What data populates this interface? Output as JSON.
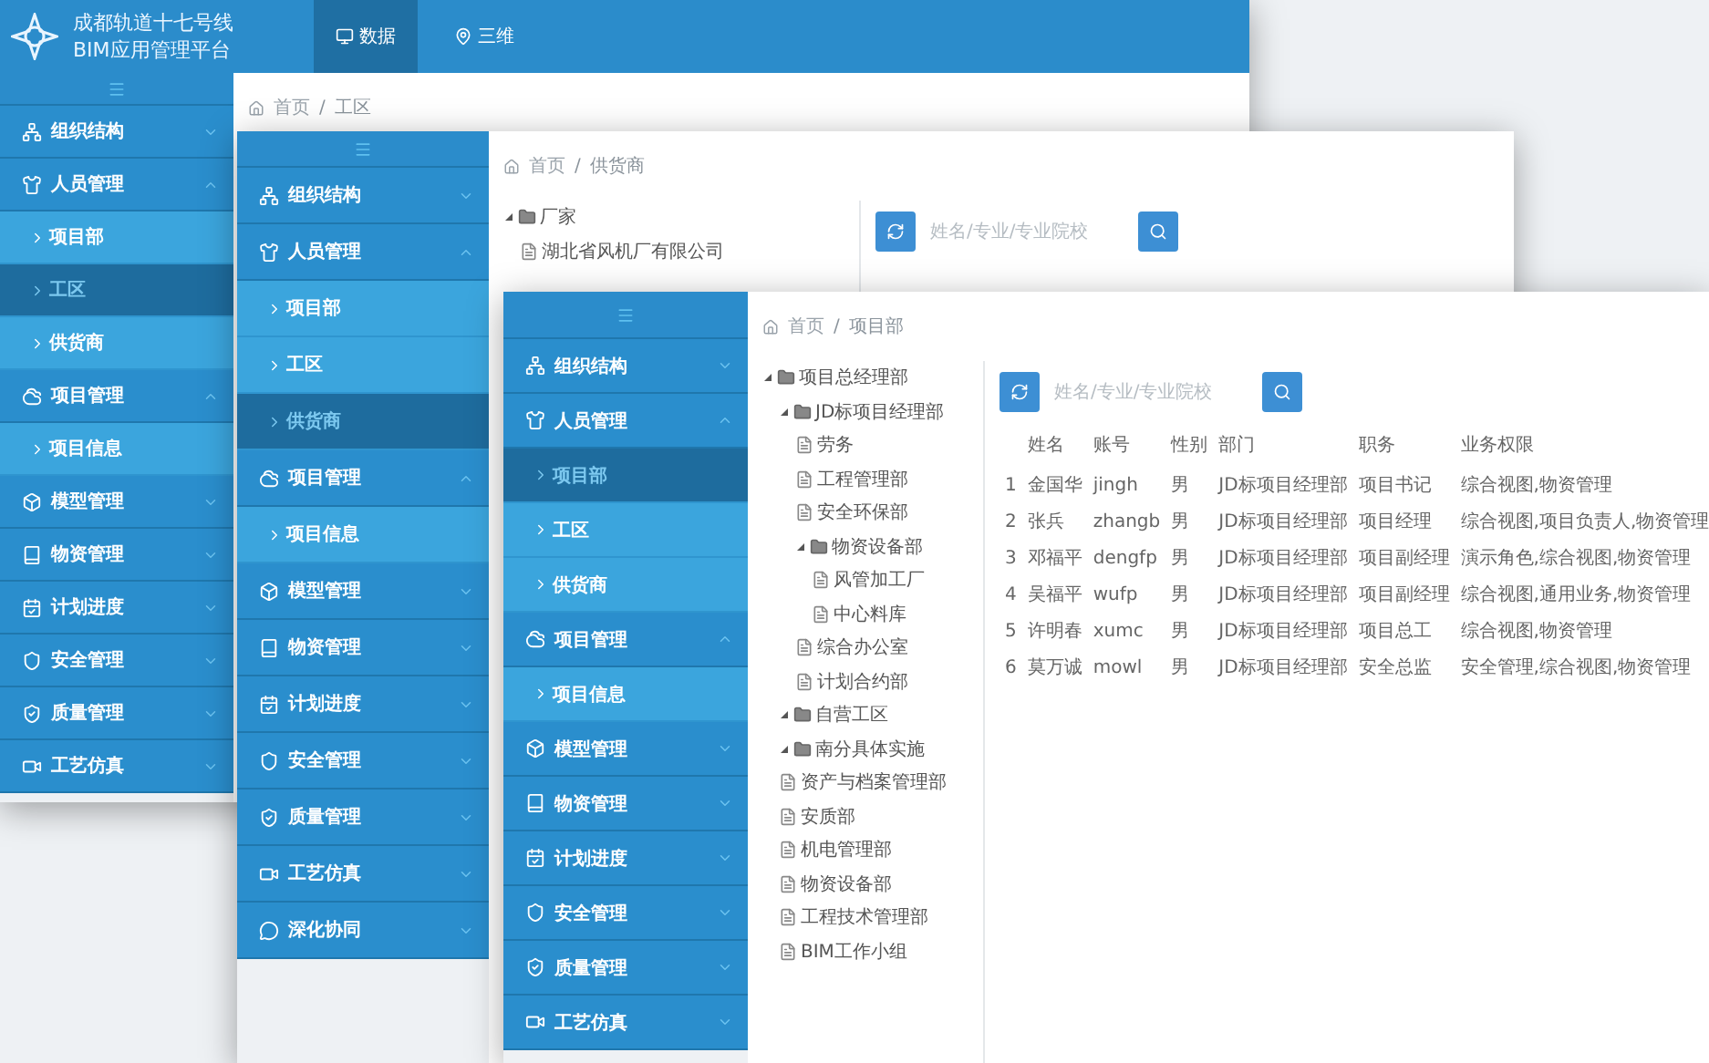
{
  "windows": [
    {
      "header": {
        "title": "成都轨道十七号线",
        "subtitle": "BIM应用管理平台",
        "tabs": [
          {
            "label": "数据",
            "selected": true
          },
          {
            "label": "三维",
            "selected": false
          }
        ]
      },
      "sidebar": {
        "groups": [
          {
            "label": "组织结构",
            "expanded": false
          },
          {
            "label": "人员管理",
            "expanded": true,
            "children": [
              {
                "label": "项目部",
                "selected": false
              },
              {
                "label": "工区",
                "selected": true
              },
              {
                "label": "供货商",
                "selected": false
              }
            ]
          },
          {
            "label": "项目管理",
            "expanded": true,
            "children": [
              {
                "label": "项目信息",
                "selected": false
              }
            ]
          },
          {
            "label": "模型管理",
            "expanded": false
          },
          {
            "label": "物资管理",
            "expanded": false
          },
          {
            "label": "计划进度",
            "expanded": false
          },
          {
            "label": "安全管理",
            "expanded": false
          },
          {
            "label": "质量管理",
            "expanded": false
          },
          {
            "label": "工艺仿真",
            "expanded": false
          }
        ]
      },
      "breadcrumb": {
        "home": "首页",
        "separator": "/",
        "current": "工区"
      }
    },
    {
      "sidebar": {
        "groups": [
          {
            "label": "组织结构",
            "expanded": false
          },
          {
            "label": "人员管理",
            "expanded": true,
            "children": [
              {
                "label": "项目部",
                "selected": false
              },
              {
                "label": "工区",
                "selected": false
              },
              {
                "label": "供货商",
                "selected": true
              }
            ]
          },
          {
            "label": "项目管理",
            "expanded": true,
            "children": [
              {
                "label": "项目信息",
                "selected": false
              }
            ]
          },
          {
            "label": "模型管理",
            "expanded": false
          },
          {
            "label": "物资管理",
            "expanded": false
          },
          {
            "label": "计划进度",
            "expanded": false
          },
          {
            "label": "安全管理",
            "expanded": false
          },
          {
            "label": "质量管理",
            "expanded": false
          },
          {
            "label": "工艺仿真",
            "expanded": false
          },
          {
            "label": "深化协同",
            "expanded": false
          }
        ]
      },
      "breadcrumb": {
        "home": "首页",
        "separator": "/",
        "current": "供货商"
      },
      "tree": [
        {
          "label": "厂家",
          "kind": "folder",
          "expanded": true,
          "children": [
            {
              "label": "湖北省风机厂有限公司",
              "kind": "file"
            }
          ]
        }
      ],
      "search": {
        "placeholder": "姓名/专业/专业院校"
      }
    },
    {
      "sidebar": {
        "groups": [
          {
            "label": "组织结构",
            "expanded": false
          },
          {
            "label": "人员管理",
            "expanded": true,
            "children": [
              {
                "label": "项目部",
                "selected": true
              },
              {
                "label": "工区",
                "selected": false
              },
              {
                "label": "供货商",
                "selected": false
              }
            ]
          },
          {
            "label": "项目管理",
            "expanded": true,
            "children": [
              {
                "label": "项目信息",
                "selected": false
              }
            ]
          },
          {
            "label": "模型管理",
            "expanded": false
          },
          {
            "label": "物资管理",
            "expanded": false
          },
          {
            "label": "计划进度",
            "expanded": false
          },
          {
            "label": "安全管理",
            "expanded": false
          },
          {
            "label": "质量管理",
            "expanded": false
          },
          {
            "label": "工艺仿真",
            "expanded": false
          }
        ]
      },
      "breadcrumb": {
        "home": "首页",
        "separator": "/",
        "current": "项目部"
      },
      "tree": [
        {
          "label": "项目总经理部",
          "kind": "folder",
          "expanded": true,
          "children": [
            {
              "label": "JD标项目经理部",
              "kind": "folder",
              "expanded": true,
              "children": [
                {
                  "label": "劳务",
                  "kind": "file"
                },
                {
                  "label": "工程管理部",
                  "kind": "file"
                },
                {
                  "label": "安全环保部",
                  "kind": "file"
                },
                {
                  "label": "物资设备部",
                  "kind": "folder",
                  "expanded": true,
                  "children": [
                    {
                      "label": "风管加工厂",
                      "kind": "file"
                    },
                    {
                      "label": "中心料库",
                      "kind": "file"
                    }
                  ]
                },
                {
                  "label": "综合办公室",
                  "kind": "file"
                },
                {
                  "label": "计划合约部",
                  "kind": "file"
                }
              ]
            },
            {
              "label": "自营工区",
              "kind": "folder",
              "expanded": true
            },
            {
              "label": "南分具体实施",
              "kind": "folder",
              "expanded": true
            },
            {
              "label": "资产与档案管理部",
              "kind": "file"
            },
            {
              "label": "安质部",
              "kind": "file"
            },
            {
              "label": "机电管理部",
              "kind": "file"
            },
            {
              "label": "物资设备部",
              "kind": "file"
            },
            {
              "label": "工程技术管理部",
              "kind": "file"
            },
            {
              "label": "BIM工作小组",
              "kind": "file"
            }
          ]
        }
      ],
      "search": {
        "placeholder": "姓名/专业/专业院校"
      },
      "table": {
        "columns": [
          "姓名",
          "账号",
          "性别",
          "部门",
          "职务",
          "业务权限"
        ],
        "rows": [
          {
            "index": "1",
            "cells": [
              "金国华",
              "jingh",
              "男",
              "JD标项目经理部",
              "项目书记",
              "综合视图,物资管理"
            ]
          },
          {
            "index": "2",
            "cells": [
              "张兵",
              "zhangb",
              "男",
              "JD标项目经理部",
              "项目经理",
              "综合视图,项目负责人,物资管理"
            ]
          },
          {
            "index": "3",
            "cells": [
              "邓福平",
              "dengfp",
              "男",
              "JD标项目经理部",
              "项目副经理",
              "演示角色,综合视图,物资管理"
            ]
          },
          {
            "index": "4",
            "cells": [
              "吴福平",
              "wufp",
              "男",
              "JD标项目经理部",
              "项目副经理",
              "综合视图,通用业务,物资管理"
            ]
          },
          {
            "index": "5",
            "cells": [
              "许明春",
              "xumc",
              "男",
              "JD标项目经理部",
              "项目总工",
              "综合视图,物资管理"
            ]
          },
          {
            "index": "6",
            "cells": [
              "莫万诚",
              "mowl",
              "男",
              "JD标项目经理部",
              "安全总监",
              "安全管理,综合视图,物资管理"
            ]
          }
        ]
      }
    }
  ]
}
